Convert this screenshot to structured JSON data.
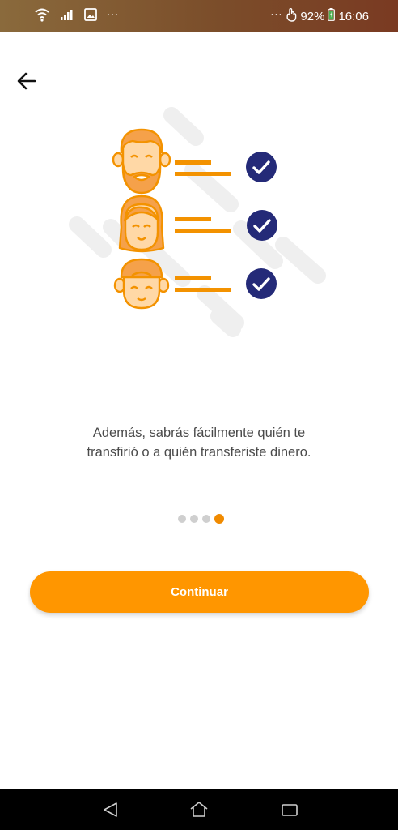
{
  "status_bar": {
    "left_icons": [
      "wifi-icon",
      "signal-icon",
      "image-notification-icon"
    ],
    "more_indicator": "···",
    "right_dots": "···",
    "battery_percent": "92%",
    "time": "16:06"
  },
  "header": {
    "back_icon": "arrow-left-icon"
  },
  "illustration": {
    "rows": [
      {
        "avatar": "bearded-man-avatar",
        "check": "check-circle-icon"
      },
      {
        "avatar": "woman-avatar",
        "check": "check-circle-icon"
      },
      {
        "avatar": "cap-man-avatar",
        "check": "check-circle-icon"
      }
    ],
    "colors": {
      "accent": "#f39200",
      "skin": "#ffd8a6",
      "hair": "#f5a14a",
      "check": "#242a78",
      "shapes": "#efefef"
    }
  },
  "content": {
    "description_line1": "Además, sabrás fácilmente quién te",
    "description_line2": "transfirió o a quién transferiste dinero."
  },
  "pager": {
    "total": 4,
    "active_index": 3
  },
  "actions": {
    "continue_label": "Continuar",
    "continue_color": "#ff9600"
  },
  "nav_bar": {
    "icons": [
      "back-triangle-icon",
      "home-icon",
      "recents-icon"
    ]
  }
}
